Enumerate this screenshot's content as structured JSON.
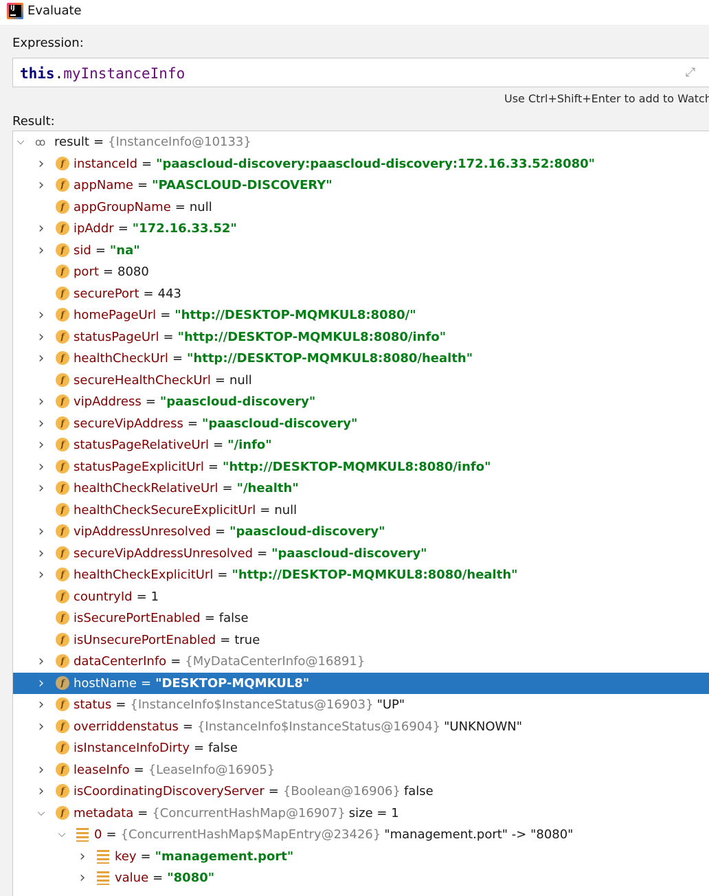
{
  "window": {
    "title": "Evaluate"
  },
  "expression": {
    "label": "Expression:",
    "keyword": "this",
    "dot": ".",
    "member": "myInstanceInfo",
    "hint": "Use Ctrl+Shift+Enter to add to Watch"
  },
  "result": {
    "label": "Result:",
    "root": {
      "name": "result",
      "ref": "{InstanceInfo@10133}"
    },
    "fields": [
      {
        "name": "instanceId",
        "kind": "str",
        "value": "\"paascloud-discovery:paascloud-discovery:172.16.33.52:8080\"",
        "expandable": true
      },
      {
        "name": "appName",
        "kind": "str",
        "value": "\"PAASCLOUD-DISCOVERY\"",
        "expandable": true
      },
      {
        "name": "appGroupName",
        "kind": "val",
        "value": "null",
        "expandable": false
      },
      {
        "name": "ipAddr",
        "kind": "str",
        "value": "\"172.16.33.52\"",
        "expandable": true
      },
      {
        "name": "sid",
        "kind": "str",
        "value": "\"na\"",
        "expandable": true
      },
      {
        "name": "port",
        "kind": "val",
        "value": "8080",
        "expandable": false
      },
      {
        "name": "securePort",
        "kind": "val",
        "value": "443",
        "expandable": false
      },
      {
        "name": "homePageUrl",
        "kind": "str",
        "value": "\"http://DESKTOP-MQMKUL8:8080/\"",
        "expandable": true
      },
      {
        "name": "statusPageUrl",
        "kind": "str",
        "value": "\"http://DESKTOP-MQMKUL8:8080/info\"",
        "expandable": true
      },
      {
        "name": "healthCheckUrl",
        "kind": "str",
        "value": "\"http://DESKTOP-MQMKUL8:8080/health\"",
        "expandable": true
      },
      {
        "name": "secureHealthCheckUrl",
        "kind": "val",
        "value": "null",
        "expandable": false
      },
      {
        "name": "vipAddress",
        "kind": "str",
        "value": "\"paascloud-discovery\"",
        "expandable": true
      },
      {
        "name": "secureVipAddress",
        "kind": "str",
        "value": "\"paascloud-discovery\"",
        "expandable": true
      },
      {
        "name": "statusPageRelativeUrl",
        "kind": "str",
        "value": "\"/info\"",
        "expandable": true
      },
      {
        "name": "statusPageExplicitUrl",
        "kind": "str",
        "value": "\"http://DESKTOP-MQMKUL8:8080/info\"",
        "expandable": true
      },
      {
        "name": "healthCheckRelativeUrl",
        "kind": "str",
        "value": "\"/health\"",
        "expandable": true
      },
      {
        "name": "healthCheckSecureExplicitUrl",
        "kind": "val",
        "value": "null",
        "expandable": false
      },
      {
        "name": "vipAddressUnresolved",
        "kind": "str",
        "value": "\"paascloud-discovery\"",
        "expandable": true
      },
      {
        "name": "secureVipAddressUnresolved",
        "kind": "str",
        "value": "\"paascloud-discovery\"",
        "expandable": true
      },
      {
        "name": "healthCheckExplicitUrl",
        "kind": "str",
        "value": "\"http://DESKTOP-MQMKUL8:8080/health\"",
        "expandable": true
      },
      {
        "name": "countryId",
        "kind": "val",
        "value": "1",
        "expandable": false
      },
      {
        "name": "isSecurePortEnabled",
        "kind": "val",
        "value": "false",
        "expandable": false
      },
      {
        "name": "isUnsecurePortEnabled",
        "kind": "val",
        "value": "true",
        "expandable": false
      },
      {
        "name": "dataCenterInfo",
        "kind": "ref",
        "value": "{MyDataCenterInfo@16891}",
        "expandable": true
      },
      {
        "name": "hostName",
        "kind": "str",
        "value": "\"DESKTOP-MQMKUL8\"",
        "expandable": true,
        "selected": true
      },
      {
        "name": "status",
        "kind": "ref",
        "value": "{InstanceInfo$InstanceStatus@16903}",
        "suffix": "\"UP\"",
        "expandable": true
      },
      {
        "name": "overriddenstatus",
        "kind": "ref",
        "value": "{InstanceInfo$InstanceStatus@16904}",
        "suffix": "\"UNKNOWN\"",
        "expandable": true
      },
      {
        "name": "isInstanceInfoDirty",
        "kind": "val",
        "value": "false",
        "expandable": false
      },
      {
        "name": "leaseInfo",
        "kind": "ref",
        "value": "{LeaseInfo@16905}",
        "expandable": true
      },
      {
        "name": "isCoordinatingDiscoveryServer",
        "kind": "ref",
        "value": "{Boolean@16906}",
        "suffix": "false",
        "expandable": true
      },
      {
        "name": "metadata",
        "kind": "ref",
        "value": "{ConcurrentHashMap@16907}",
        "suffix": " size = 1",
        "expandable": true,
        "expanded": true
      }
    ],
    "metadata_children": [
      {
        "name": "0",
        "kind": "ref",
        "value": "{ConcurrentHashMap$MapEntry@23426}",
        "suffix": "\"management.port\" -> \"8080\"",
        "expanded": true,
        "level": 1
      },
      {
        "name": "key",
        "kind": "str",
        "value": "\"management.port\"",
        "level": 2
      },
      {
        "name": "value",
        "kind": "str",
        "value": "\"8080\"",
        "level": 2
      }
    ]
  }
}
